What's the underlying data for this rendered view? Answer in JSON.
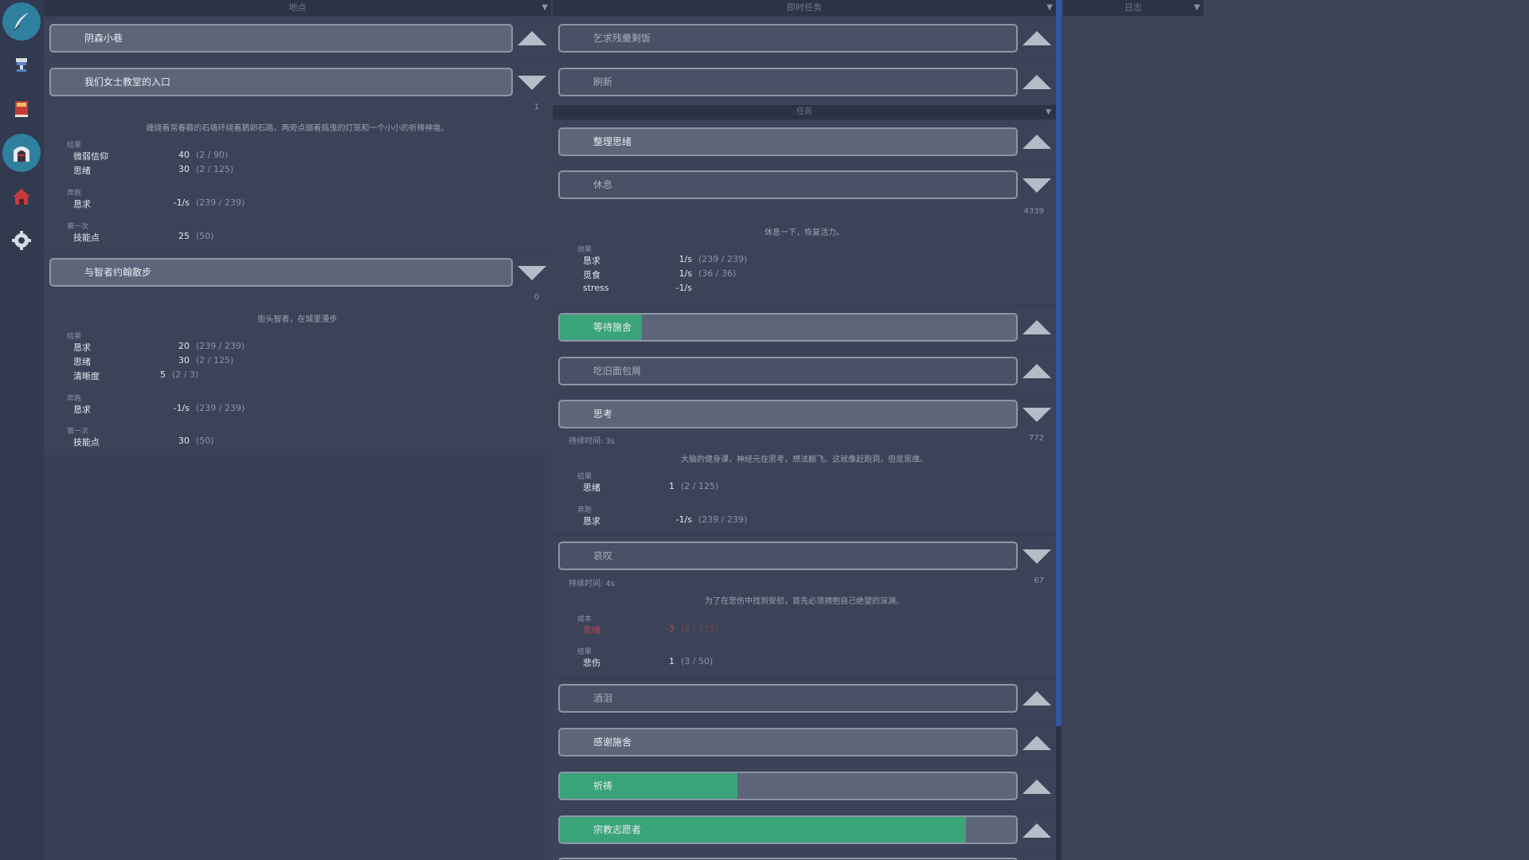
{
  "nav": {
    "items": [
      {
        "icon": "quill-icon",
        "active": true
      },
      {
        "icon": "trophy-icon",
        "active": false
      },
      {
        "icon": "book-icon",
        "active": false
      },
      {
        "icon": "gate-icon",
        "active": true
      },
      {
        "icon": "house-icon",
        "active": false
      },
      {
        "icon": "gear-icon",
        "active": false
      }
    ]
  },
  "panels": {
    "locations": {
      "title": "地点"
    },
    "tasks": {
      "title": "即时任务",
      "subtitle": "任务"
    },
    "log": {
      "title": "日志"
    }
  },
  "locations": {
    "loc1": {
      "label": "阴森小巷"
    },
    "loc2": {
      "label": "我们女士教堂的入口",
      "count": "1",
      "desc": "缠绕着常春藤的石墙环绕着鹅卵石路，两旁点缀着摇曳的灯笼和一个小小的祈祷神龛。",
      "sec_result": "结果",
      "r1": {
        "label": "微弱信仰",
        "value": "40",
        "max": "(2 / 90)"
      },
      "r2": {
        "label": "思绪",
        "value": "30",
        "max": "(2 / 125)"
      },
      "sec_run": "奔跑",
      "r3": {
        "label": "恳求",
        "value": "-1/s",
        "max": "(239 / 239)"
      },
      "sec_first": "第一次",
      "r4": {
        "label": "技能点",
        "value": "25",
        "max": "(50)"
      }
    },
    "loc3": {
      "label": "与智者约翰散步",
      "count": "0",
      "desc": "街头智者，在城里漫步",
      "sec_result": "结果",
      "r1": {
        "label": "恳求",
        "value": "20",
        "max": "(239 / 239)"
      },
      "r2": {
        "label": "思绪",
        "value": "30",
        "max": "(2 / 125)"
      },
      "r3": {
        "label": "清晰度",
        "value": "5",
        "max": "(2 / 3)"
      },
      "sec_run": "奔跑",
      "r4": {
        "label": "恳求",
        "value": "-1/s",
        "max": "(239 / 239)"
      },
      "sec_first": "第一次",
      "r5": {
        "label": "技能点",
        "value": "30",
        "max": "(50)"
      }
    }
  },
  "tasks": {
    "t1": {
      "label": "乞求残羹剩饭"
    },
    "t2": {
      "label": "刷新"
    },
    "t3": {
      "label": "整理思绪"
    },
    "t4": {
      "label": "休息",
      "count": "4339",
      "desc": "休息一下，恢复活力。",
      "sec": "效果",
      "r1": {
        "label": "恳求",
        "value": "1/s",
        "max": "(239 / 239)"
      },
      "r2": {
        "label": "觅食",
        "value": "1/s",
        "max": "(36 / 36)"
      },
      "r3": {
        "label": "stress",
        "value": "-1/s"
      }
    },
    "t5": {
      "label": "等待施舍",
      "progress": 0.18
    },
    "t6": {
      "label": "吃旧面包屑"
    },
    "t7": {
      "label": "思考",
      "duration": "持续时间: 3s",
      "count": "772",
      "desc": "大脑的健身课，神经元在思考，想法翻飞。这就像赶跑洞，但是思维。",
      "sec_result": "结果",
      "r1": {
        "label": "思绪",
        "value": "1",
        "max": "(2 / 125)"
      },
      "sec_run": "奔跑",
      "r2": {
        "label": "恳求",
        "value": "-1/s",
        "max": "(239 / 239)"
      }
    },
    "t8": {
      "label": "哀叹",
      "duration": "持续时间: 4s",
      "count": "67",
      "desc": "为了在悲伤中找到安慰，首先必须拥抱自己绝望的深渊。",
      "sec_cost": "成本",
      "c1": {
        "label": "思绪",
        "value": "-3",
        "max": "(2 / 125)"
      },
      "sec_result": "结果",
      "r1": {
        "label": "悲伤",
        "value": "1",
        "max": "(3 / 50)"
      }
    },
    "t9": {
      "label": "酒泪"
    },
    "t10": {
      "label": "感谢施舍"
    },
    "t11": {
      "label": "祈祷",
      "progress": 0.39
    },
    "t12": {
      "label": "宗教志愿者",
      "progress": 0.89
    }
  },
  "colors": {
    "progress": "#3aa37a",
    "accent": "#2f7f9f",
    "cost_red": "#b84848",
    "scroll": "#3158a0"
  }
}
